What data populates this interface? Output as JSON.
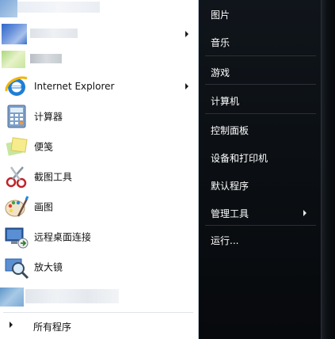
{
  "programs": [
    {
      "label": "Internet Explorer",
      "icon": "internet-explorer-icon",
      "has_submenu": true
    },
    {
      "label": "计算器",
      "icon": "calculator-icon",
      "has_submenu": false
    },
    {
      "label": "便笺",
      "icon": "sticky-notes-icon",
      "has_submenu": false
    },
    {
      "label": "截图工具",
      "icon": "snipping-tool-icon",
      "has_submenu": false
    },
    {
      "label": "画图",
      "icon": "paint-icon",
      "has_submenu": false
    },
    {
      "label": "远程桌面连接",
      "icon": "remote-desktop-icon",
      "has_submenu": false
    },
    {
      "label": "放大镜",
      "icon": "magnifier-icon",
      "has_submenu": false
    }
  ],
  "all_programs_label": "所有程序",
  "right_items": [
    {
      "label": "图片",
      "has_submenu": false
    },
    {
      "label": "音乐",
      "has_submenu": false
    },
    {
      "label": "游戏",
      "has_submenu": false
    },
    {
      "label": "计算机",
      "has_submenu": false
    },
    {
      "label": "控制面板",
      "has_submenu": false
    },
    {
      "label": "设备和打印机",
      "has_submenu": false
    },
    {
      "label": "默认程序",
      "has_submenu": false
    },
    {
      "label": "管理工具",
      "has_submenu": true
    },
    {
      "label": "运行...",
      "has_submenu": false
    }
  ],
  "colors": {
    "left_bg": "#ffffff",
    "right_bg": "#0b0f13",
    "right_text": "#ffffff"
  }
}
